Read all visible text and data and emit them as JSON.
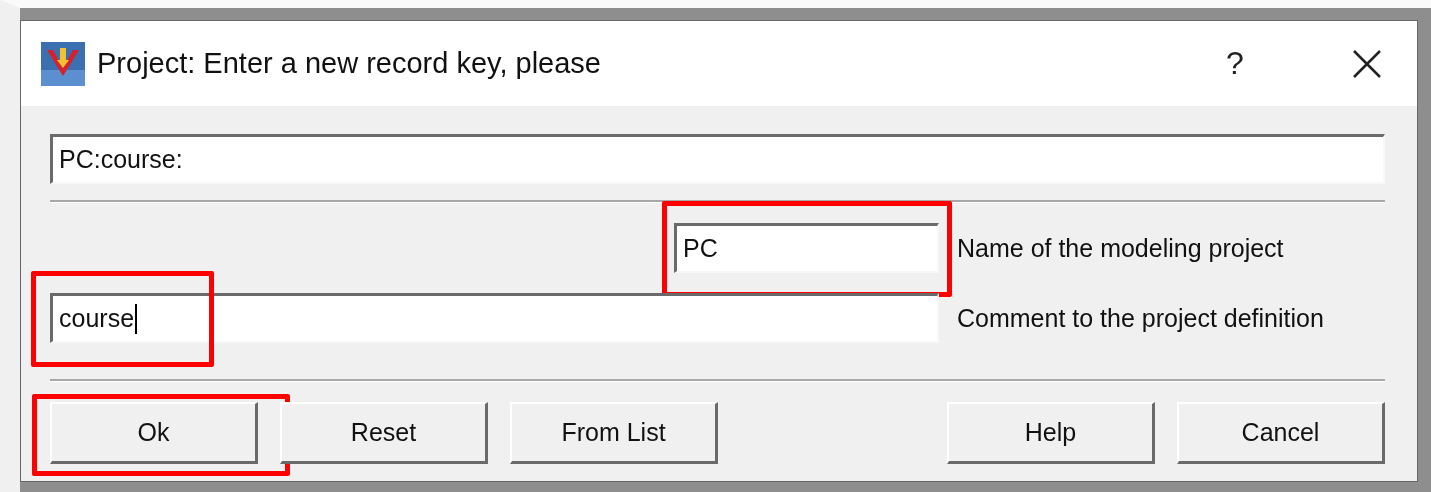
{
  "window": {
    "title": "Project: Enter a new record key, please",
    "help": "?"
  },
  "key_field": {
    "value": "PC:course:"
  },
  "fields": [
    {
      "kind": "short",
      "value": "PC",
      "label": "Name of the modeling project",
      "focused": false,
      "highlighted": true
    },
    {
      "kind": "wide",
      "value": "course",
      "label": "Comment to the project definition",
      "focused": true,
      "highlighted": true
    }
  ],
  "buttons_left": [
    {
      "label": "Ok",
      "highlighted": true
    },
    {
      "label": "Reset",
      "highlighted": false
    },
    {
      "label": "From List",
      "highlighted": false
    }
  ],
  "buttons_right": [
    {
      "label": "Help",
      "highlighted": false
    },
    {
      "label": "Cancel",
      "highlighted": false
    }
  ]
}
